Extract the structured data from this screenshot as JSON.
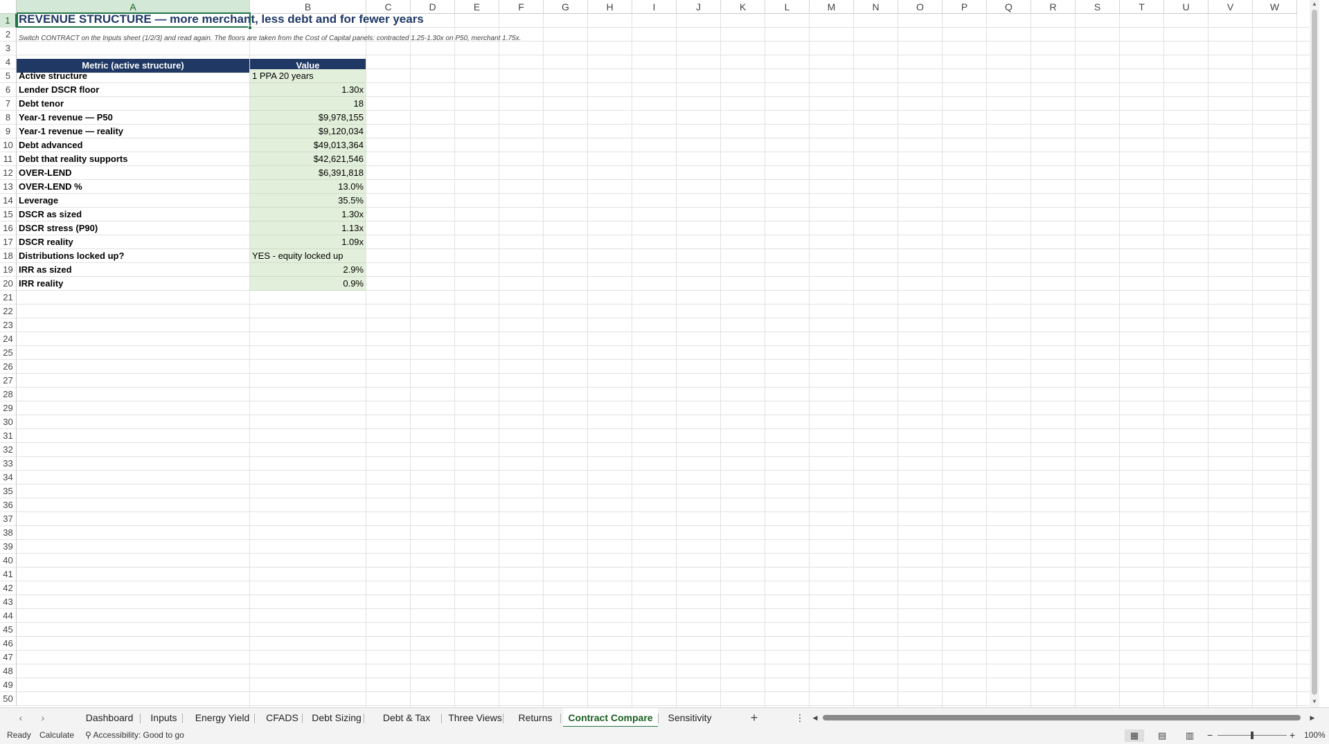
{
  "columns": [
    "A",
    "B",
    "C",
    "D",
    "E",
    "F",
    "G",
    "H",
    "I",
    "J",
    "K",
    "L",
    "M",
    "N",
    "O",
    "P",
    "Q",
    "R",
    "S",
    "T",
    "U",
    "V",
    "W"
  ],
  "rows": [
    "1",
    "2",
    "3",
    "4",
    "5",
    "6",
    "7",
    "8",
    "9",
    "10",
    "11",
    "12",
    "13",
    "14",
    "15",
    "16",
    "17",
    "18",
    "19",
    "20",
    "21",
    "22",
    "23",
    "24",
    "25",
    "26",
    "27",
    "28",
    "29",
    "30",
    "31",
    "32",
    "33",
    "34",
    "35",
    "36",
    "37",
    "38",
    "39",
    "40",
    "41",
    "42",
    "43",
    "44",
    "45",
    "46",
    "47",
    "48",
    "49",
    "50"
  ],
  "sheet": {
    "title": "REVENUE STRUCTURE — more merchant, less debt and for fewer years",
    "note": "Switch CONTRACT on the Inputs sheet (1/2/3) and read again. The floors are taken from the Cost of Capital panels: contracted 1.25-1.30x on P50, merchant 1.75x.",
    "header_metric": "Metric (active structure)",
    "header_value": "Value",
    "table": [
      {
        "label": "Active structure",
        "value": "1 PPA 20 years"
      },
      {
        "label": "Lender DSCR floor",
        "value": "1.30x"
      },
      {
        "label": "Debt tenor",
        "value": "18"
      },
      {
        "label": "Year-1 revenue — P50",
        "value": "$9,978,155"
      },
      {
        "label": "Year-1 revenue — reality",
        "value": "$9,120,034"
      },
      {
        "label": "Debt advanced",
        "value": "$49,013,364"
      },
      {
        "label": "Debt that reality supports",
        "value": "$42,621,546"
      },
      {
        "label": "OVER-LEND",
        "value": "$6,391,818"
      },
      {
        "label": "OVER-LEND %",
        "value": "13.0%"
      },
      {
        "label": "Leverage",
        "value": "35.5%"
      },
      {
        "label": "DSCR as sized",
        "value": "1.30x"
      },
      {
        "label": "DSCR stress (P90)",
        "value": "1.13x"
      },
      {
        "label": "DSCR reality",
        "value": "1.09x"
      },
      {
        "label": "Distributions locked up?",
        "value": "YES - equity locked up"
      },
      {
        "label": "IRR as sized",
        "value": "2.9%"
      },
      {
        "label": "IRR reality",
        "value": "0.9%"
      }
    ]
  },
  "tabs": [
    "Dashboard",
    "Inputs",
    "Energy Yield",
    "CFADS",
    "Debt Sizing",
    "Debt & Tax",
    "Three Views",
    "Returns",
    "Contract Compare",
    "Sensitivity"
  ],
  "active_tab": "Contract Compare",
  "status": {
    "ready": "Ready",
    "calculate": "Calculate",
    "accessibility": "Accessibility: Good to go",
    "zoom": "100%"
  },
  "colors": {
    "header_fill": "#1f3864",
    "value_fill": "#e2efda",
    "accent": "#217346"
  }
}
